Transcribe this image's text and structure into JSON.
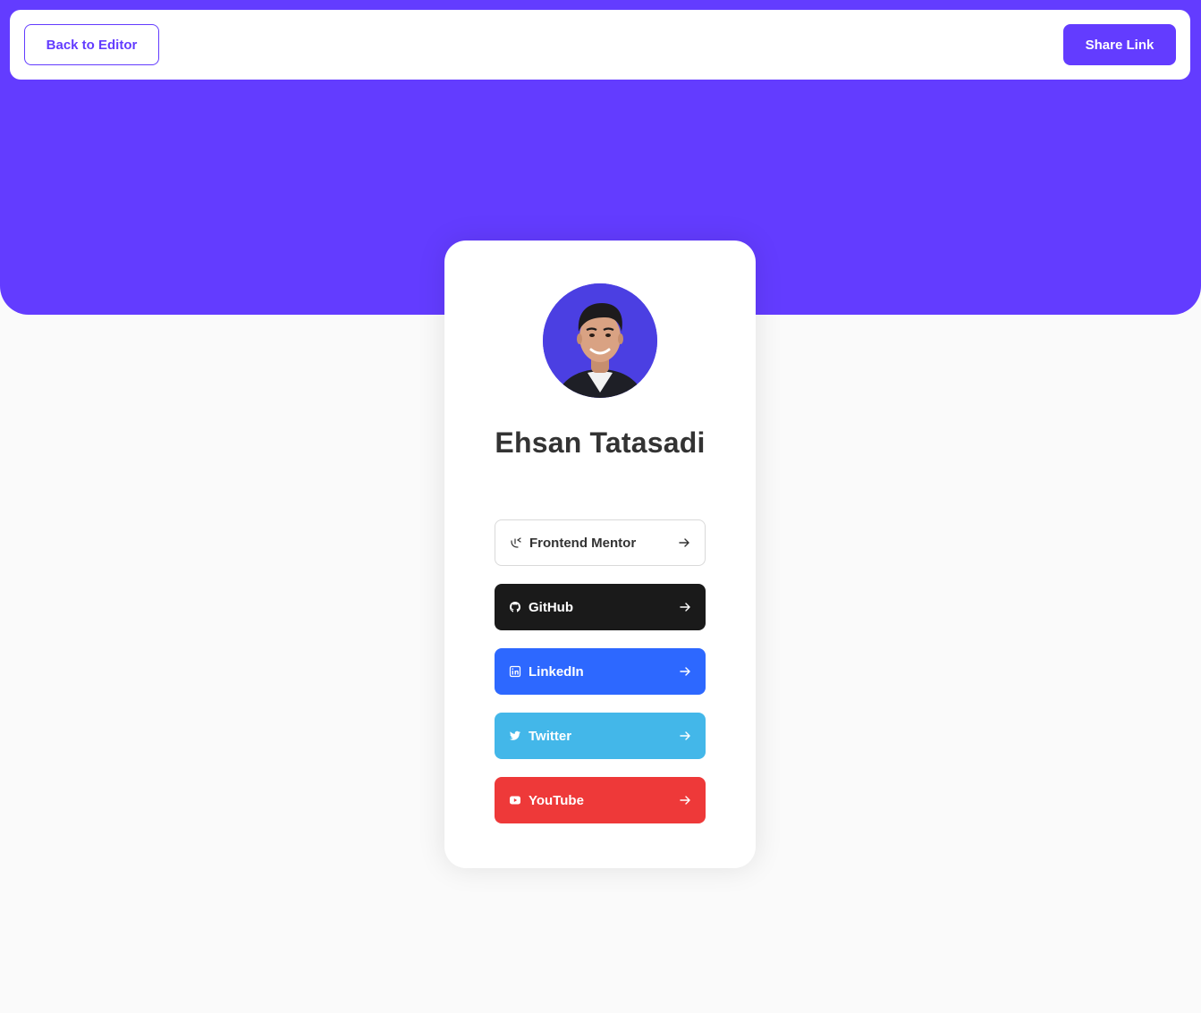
{
  "header": {
    "back_label": "Back to Editor",
    "share_label": "Share Link"
  },
  "profile": {
    "name": "Ehsan Tatasadi",
    "avatar_icon": "profile-photo"
  },
  "colors": {
    "brand": "#633cff",
    "page_bg": "#fafafa"
  },
  "links": [
    {
      "label": "Frontend Mentor",
      "icon": "frontend-mentor-icon",
      "bg": "#ffffff",
      "fg": "#333333"
    },
    {
      "label": "GitHub",
      "icon": "github-icon",
      "bg": "#1a1a1a",
      "fg": "#ffffff"
    },
    {
      "label": "LinkedIn",
      "icon": "linkedin-icon",
      "bg": "#2d68ff",
      "fg": "#ffffff"
    },
    {
      "label": "Twitter",
      "icon": "twitter-icon",
      "bg": "#43b7e9",
      "fg": "#ffffff"
    },
    {
      "label": "YouTube",
      "icon": "youtube-icon",
      "bg": "#ee3939",
      "fg": "#ffffff"
    }
  ]
}
